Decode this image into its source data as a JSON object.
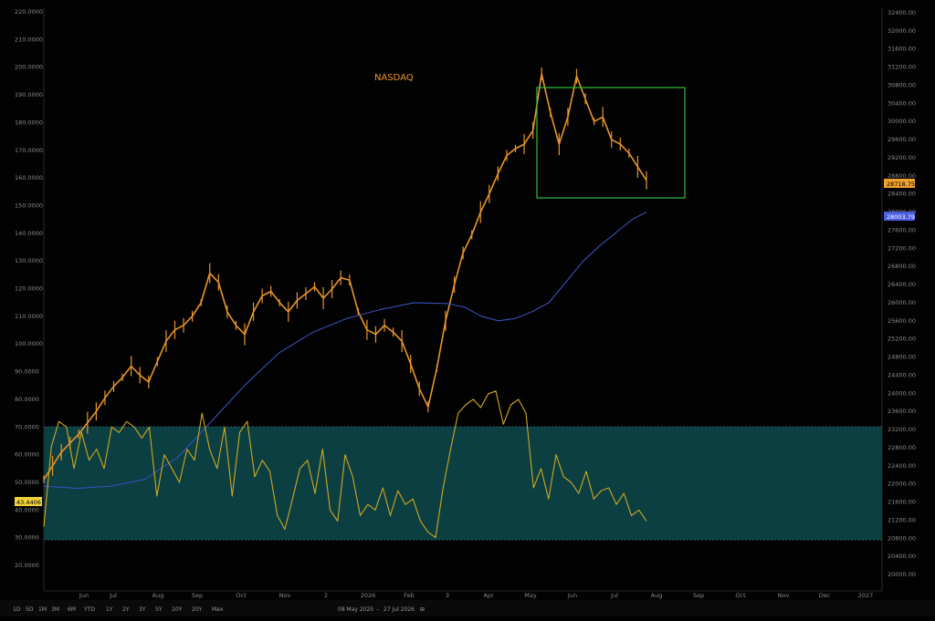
{
  "chart_data": {
    "type": "line",
    "title": "NASDAQ",
    "left_axis": {
      "ticks": [
        "220.0000",
        "210.0000",
        "200.0000",
        "190.0000",
        "180.0000",
        "170.0000",
        "160.0000",
        "150.0000",
        "140.0000",
        "130.0000",
        "120.0000",
        "110.0000",
        "100.0000",
        "90.0000",
        "80.0000",
        "70.0000",
        "60.0000",
        "50.0000",
        "40.0000",
        "30.0000",
        "20.0000"
      ],
      "range": [
        20,
        220
      ],
      "current_label": "43.4406"
    },
    "right_axis": {
      "ticks": [
        "32400.00",
        "32000.00",
        "31600.00",
        "31200.00",
        "30800.00",
        "30400.00",
        "30000.00",
        "29600.00",
        "29200.00",
        "28800.00",
        "28400.00",
        "28000.00",
        "27600.00",
        "27200.00",
        "26800.00",
        "26400.00",
        "26000.00",
        "25600.00",
        "25200.00",
        "24800.00",
        "24400.00",
        "24000.00",
        "23600.00",
        "23200.00",
        "22800.00",
        "22400.00",
        "22000.00",
        "21600.00",
        "21200.00",
        "20800.00",
        "20400.00",
        "20000.00"
      ],
      "range": [
        20000,
        32400
      ],
      "price_label": "28718.75",
      "ma_label": "28003.79"
    },
    "x_months": [
      "Jun",
      "Jul",
      "Aug",
      "Sep",
      "Oct",
      "Nov",
      "2",
      "2026",
      "Feb",
      "3",
      "Apr",
      "May",
      "Jun",
      "Jul",
      "Aug",
      "Sep",
      "Oct",
      "Nov",
      "Dec",
      "2027"
    ],
    "rsi_band": [
      30,
      70
    ],
    "series": [
      {
        "key": "price",
        "color": "#e8952a",
        "points": [
          [
            0,
            22100
          ],
          [
            2,
            22400
          ],
          [
            4,
            22700
          ],
          [
            6,
            22900
          ],
          [
            8,
            23100
          ],
          [
            10,
            23350
          ],
          [
            12,
            23600
          ],
          [
            14,
            23900
          ],
          [
            16,
            24150
          ],
          [
            18,
            24350
          ],
          [
            20,
            24600
          ],
          [
            22,
            24400
          ],
          [
            24,
            24250
          ],
          [
            26,
            24700
          ],
          [
            28,
            25150
          ],
          [
            30,
            25400
          ],
          [
            32,
            25500
          ],
          [
            34,
            25700
          ],
          [
            36,
            26000
          ],
          [
            38,
            26650
          ],
          [
            40,
            26450
          ],
          [
            42,
            25800
          ],
          [
            44,
            25500
          ],
          [
            46,
            25300
          ],
          [
            48,
            25800
          ],
          [
            50,
            26150
          ],
          [
            52,
            26250
          ],
          [
            54,
            26000
          ],
          [
            56,
            25800
          ],
          [
            58,
            26050
          ],
          [
            60,
            26200
          ],
          [
            62,
            26350
          ],
          [
            64,
            26100
          ],
          [
            66,
            26300
          ],
          [
            68,
            26550
          ],
          [
            70,
            26500
          ],
          [
            72,
            25800
          ],
          [
            74,
            25400
          ],
          [
            76,
            25300
          ],
          [
            78,
            25500
          ],
          [
            80,
            25350
          ],
          [
            82,
            25150
          ],
          [
            84,
            24650
          ],
          [
            86,
            24100
          ],
          [
            88,
            23700
          ],
          [
            90,
            24550
          ],
          [
            92,
            25600
          ],
          [
            94,
            26400
          ],
          [
            96,
            27100
          ],
          [
            98,
            27500
          ],
          [
            100,
            28000
          ],
          [
            102,
            28400
          ],
          [
            104,
            28850
          ],
          [
            106,
            29250
          ],
          [
            108,
            29400
          ],
          [
            110,
            29500
          ],
          [
            112,
            29800
          ],
          [
            114,
            31050
          ],
          [
            116,
            30200
          ],
          [
            118,
            29500
          ],
          [
            120,
            30100
          ],
          [
            122,
            31000
          ],
          [
            124,
            30500
          ],
          [
            126,
            30000
          ],
          [
            128,
            30100
          ],
          [
            130,
            29600
          ],
          [
            132,
            29500
          ],
          [
            134,
            29300
          ],
          [
            136,
            29000
          ],
          [
            138,
            28700
          ]
        ]
      },
      {
        "key": "ma",
        "color": "#3a4fb8",
        "points": [
          [
            0,
            21950
          ],
          [
            10,
            21900
          ],
          [
            20,
            21950
          ],
          [
            30,
            22100
          ],
          [
            40,
            22600
          ],
          [
            50,
            23400
          ],
          [
            60,
            24200
          ],
          [
            70,
            24900
          ],
          [
            80,
            25350
          ],
          [
            90,
            25650
          ],
          [
            100,
            25850
          ],
          [
            110,
            26000
          ],
          [
            120,
            25980
          ],
          [
            125,
            25900
          ],
          [
            130,
            25700
          ],
          [
            135,
            25600
          ],
          [
            140,
            25650
          ],
          [
            145,
            25800
          ],
          [
            150,
            26000
          ],
          [
            155,
            26450
          ],
          [
            160,
            26900
          ],
          [
            165,
            27250
          ],
          [
            170,
            27550
          ],
          [
            175,
            27850
          ],
          [
            179,
            28000
          ]
        ]
      },
      {
        "key": "rsi",
        "color": "#d0a820",
        "points": [
          [
            0,
            34
          ],
          [
            1,
            63
          ],
          [
            2,
            72
          ],
          [
            3,
            70
          ],
          [
            4,
            55
          ],
          [
            5,
            68
          ],
          [
            6,
            58
          ],
          [
            7,
            62
          ],
          [
            8,
            55
          ],
          [
            9,
            70
          ],
          [
            10,
            68
          ],
          [
            11,
            72
          ],
          [
            12,
            70
          ],
          [
            13,
            66
          ],
          [
            14,
            70
          ],
          [
            15,
            45
          ],
          [
            16,
            60
          ],
          [
            17,
            55
          ],
          [
            18,
            50
          ],
          [
            19,
            62
          ],
          [
            20,
            58
          ],
          [
            21,
            75
          ],
          [
            22,
            62
          ],
          [
            23,
            55
          ],
          [
            24,
            70
          ],
          [
            25,
            45
          ],
          [
            26,
            68
          ],
          [
            27,
            72
          ],
          [
            28,
            52
          ],
          [
            29,
            58
          ],
          [
            30,
            54
          ],
          [
            31,
            38
          ],
          [
            32,
            33
          ],
          [
            33,
            44
          ],
          [
            34,
            55
          ],
          [
            35,
            58
          ],
          [
            36,
            46
          ],
          [
            37,
            62
          ],
          [
            38,
            40
          ],
          [
            39,
            36
          ],
          [
            40,
            60
          ],
          [
            41,
            52
          ],
          [
            42,
            38
          ],
          [
            43,
            42
          ],
          [
            44,
            40
          ],
          [
            45,
            48
          ],
          [
            46,
            38
          ],
          [
            47,
            47
          ],
          [
            48,
            42
          ],
          [
            49,
            44
          ],
          [
            50,
            36
          ],
          [
            51,
            32
          ],
          [
            52,
            30
          ],
          [
            53,
            48
          ],
          [
            54,
            62
          ],
          [
            55,
            75
          ],
          [
            56,
            78
          ],
          [
            57,
            80
          ],
          [
            58,
            77
          ],
          [
            59,
            82
          ],
          [
            60,
            83
          ],
          [
            61,
            71
          ],
          [
            62,
            78
          ],
          [
            63,
            80
          ],
          [
            64,
            75
          ],
          [
            65,
            48
          ],
          [
            66,
            55
          ],
          [
            67,
            44
          ],
          [
            68,
            60
          ],
          [
            69,
            52
          ],
          [
            70,
            50
          ],
          [
            71,
            46
          ],
          [
            72,
            54
          ],
          [
            73,
            44
          ],
          [
            74,
            47
          ],
          [
            75,
            48
          ],
          [
            76,
            42
          ],
          [
            77,
            46
          ],
          [
            78,
            38
          ],
          [
            79,
            40
          ],
          [
            80,
            36
          ]
        ]
      }
    ],
    "grid": false,
    "legend": "none"
  },
  "bottom_bar": {
    "timeframes": [
      "1D",
      "5D",
      "1M",
      "3M",
      "6M",
      "YTD",
      "1Y",
      "2Y",
      "3Y",
      "5Y",
      "10Y",
      "20Y",
      "Max"
    ],
    "date_from": "08 May 2025",
    "date_to": "27 Jul 2026"
  },
  "colors": {
    "background": "#020202",
    "price": "#e8952a",
    "moving_average": "#3a4fb8",
    "rsi": "#d0a820",
    "rsi_band_fill": "#0b3f42",
    "highlight_box": "#2fbf3a",
    "price_tag": "#f0a12e",
    "ma_tag": "#4b5ee0",
    "rsi_tag": "#f1d23a"
  }
}
